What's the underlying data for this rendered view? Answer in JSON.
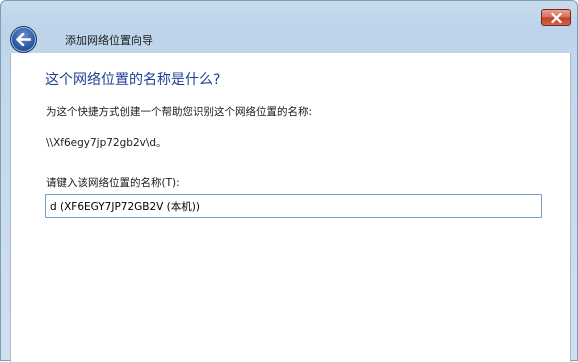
{
  "window": {
    "title": "添加网络位置向导",
    "accent_color": "#1c3f94"
  },
  "icons": {
    "back": "back-arrow-icon",
    "close": "close-icon"
  },
  "main": {
    "heading": "这个网络位置的名称是什么?",
    "description": "为这个快捷方式创建一个帮助您识别这个网络位置的名称:",
    "network_path": "\\\\Xf6egy7jp72gb2v\\d。",
    "field_label": "请键入该网络位置的名称(T):",
    "field_value": "d (XF6EGY7JP72GB2V (本机))"
  }
}
